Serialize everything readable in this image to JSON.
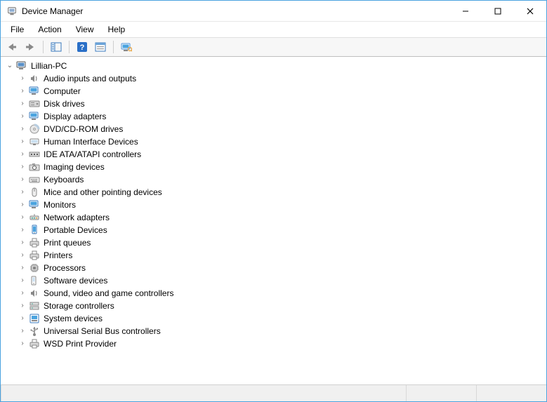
{
  "window": {
    "title": "Device Manager"
  },
  "menu": {
    "file": "File",
    "action": "Action",
    "view": "View",
    "help": "Help"
  },
  "root": {
    "label": "Lillian-PC"
  },
  "categories": [
    {
      "label": "Audio inputs and outputs",
      "icon": "speaker"
    },
    {
      "label": "Computer",
      "icon": "monitor"
    },
    {
      "label": "Disk drives",
      "icon": "disk"
    },
    {
      "label": "Display adapters",
      "icon": "monitor"
    },
    {
      "label": "DVD/CD-ROM drives",
      "icon": "disc"
    },
    {
      "label": "Human Interface Devices",
      "icon": "hid"
    },
    {
      "label": "IDE ATA/ATAPI controllers",
      "icon": "ide"
    },
    {
      "label": "Imaging devices",
      "icon": "camera"
    },
    {
      "label": "Keyboards",
      "icon": "keyboard"
    },
    {
      "label": "Mice and other pointing devices",
      "icon": "mouse"
    },
    {
      "label": "Monitors",
      "icon": "monitor"
    },
    {
      "label": "Network adapters",
      "icon": "network"
    },
    {
      "label": "Portable Devices",
      "icon": "portable"
    },
    {
      "label": "Print queues",
      "icon": "printer"
    },
    {
      "label": "Printers",
      "icon": "printer"
    },
    {
      "label": "Processors",
      "icon": "cpu"
    },
    {
      "label": "Software devices",
      "icon": "software"
    },
    {
      "label": "Sound, video and game controllers",
      "icon": "speaker"
    },
    {
      "label": "Storage controllers",
      "icon": "storage"
    },
    {
      "label": "System devices",
      "icon": "system"
    },
    {
      "label": "Universal Serial Bus controllers",
      "icon": "usb"
    },
    {
      "label": "WSD Print Provider",
      "icon": "printer"
    }
  ]
}
